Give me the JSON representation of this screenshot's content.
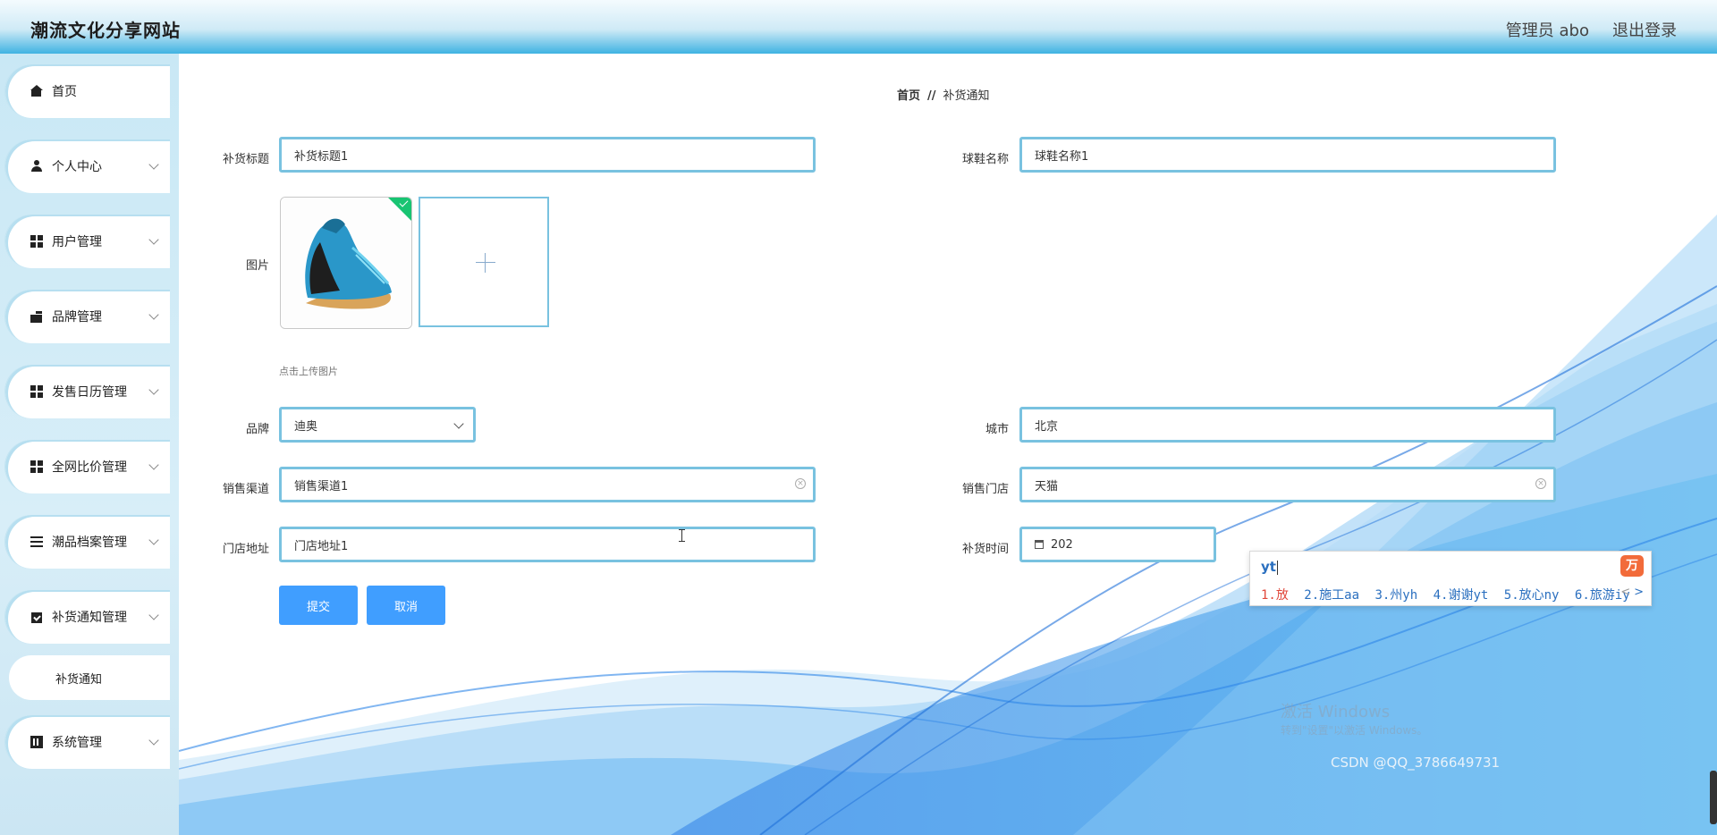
{
  "header": {
    "site_title": "潮流文化分享网站",
    "admin_label": "管理员 abo",
    "logout_label": "退出登录"
  },
  "sidebar": {
    "items": [
      {
        "label": "首页",
        "icon": "home-icon",
        "has_children": false
      },
      {
        "label": "个人中心",
        "icon": "user-icon",
        "has_children": true
      },
      {
        "label": "用户管理",
        "icon": "grid-icon",
        "has_children": true
      },
      {
        "label": "品牌管理",
        "icon": "wallet-icon",
        "has_children": true
      },
      {
        "label": "发售日历管理",
        "icon": "grid-icon",
        "has_children": true
      },
      {
        "label": "全网比价管理",
        "icon": "grid-icon",
        "has_children": true
      },
      {
        "label": "潮品档案管理",
        "icon": "list-icon",
        "has_children": true
      },
      {
        "label": "补货通知管理",
        "icon": "clipboard-icon",
        "has_children": true,
        "expanded": true
      },
      {
        "label": "系统管理",
        "icon": "bars-icon",
        "has_children": true
      }
    ],
    "submenu": {
      "label": "补货通知"
    }
  },
  "breadcrumb": {
    "home": "首页",
    "separator": "//",
    "current": "补货通知"
  },
  "form": {
    "title": {
      "label": "补货标题",
      "value": "补货标题1"
    },
    "shoe_name": {
      "label": "球鞋名称",
      "value": "球鞋名称1"
    },
    "image": {
      "label": "图片",
      "hint": "点击上传图片"
    },
    "brand": {
      "label": "品牌",
      "value": "迪奥"
    },
    "city": {
      "label": "城市",
      "value": "北京"
    },
    "channel": {
      "label": "销售渠道",
      "value": "销售渠道1"
    },
    "store": {
      "label": "销售门店",
      "value": "天猫"
    },
    "address": {
      "label": "门店地址",
      "value": "门店地址1"
    },
    "restock_time": {
      "label": "补货时间",
      "value": "202"
    }
  },
  "buttons": {
    "submit": "提交",
    "cancel": "取消"
  },
  "ime": {
    "input": "yt",
    "logo": "万",
    "candidates": [
      "1.放",
      "2.施工aa",
      "3.州yh",
      "4.谢谢yt",
      "5.放心ny",
      "6.旅游iy"
    ],
    "nav_prev": "<",
    "nav_next": ">"
  },
  "watermark": {
    "line1": "激活 Windows",
    "line2": "转到\"设置\"以激活 Windows。",
    "csdn": "CSDN @QQ_3786649731"
  },
  "colors": {
    "accent": "#409eff",
    "input_border": "#79c2e0",
    "sidebar_bg": "#cfeaf6",
    "success": "#18c472"
  }
}
